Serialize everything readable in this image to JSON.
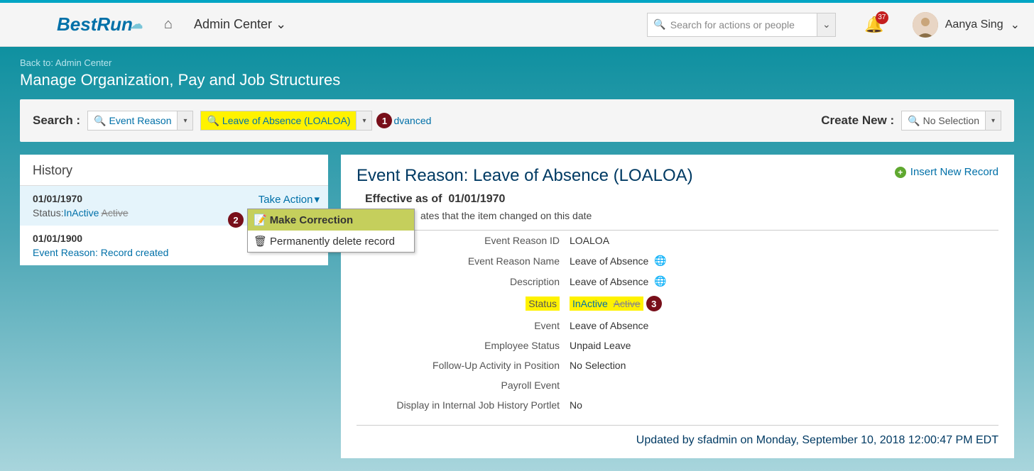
{
  "header": {
    "logo": "BestRun",
    "nav_label": "Admin Center",
    "search_placeholder": "Search for actions or people",
    "notif_count": "37",
    "user_name": "Aanya Sing"
  },
  "breadcrumb": {
    "back": "Back to: Admin Center",
    "title": "Manage Organization, Pay and Job Structures"
  },
  "searchbar": {
    "label": "Search :",
    "filter1": "Event Reason",
    "filter2": "Leave of Absence (LOALOA)",
    "advanced": "dvanced",
    "create_label": "Create New :",
    "create_value": "No Selection"
  },
  "callouts": {
    "c1": "1",
    "c2": "2",
    "c3": "3"
  },
  "history": {
    "title": "History",
    "items": [
      {
        "date": "01/01/1970",
        "status_label": "Status:",
        "status_val": "InActive",
        "status_old": "Active",
        "action": "Take Action"
      },
      {
        "date": "01/01/1900",
        "sub": "Event Reason: Record created"
      }
    ],
    "menu": {
      "correct": "Make Correction",
      "delete": "Permanently delete record"
    }
  },
  "detail": {
    "title": "Event Reason: Leave of Absence (LOALOA)",
    "insert": "Insert New Record",
    "effective_label": "Effective as of",
    "effective_date": "01/01/1970",
    "note": "ates that the item changed on this date",
    "fields": {
      "id_label": "Event Reason ID",
      "id_val": "LOALOA",
      "name_label": "Event Reason Name",
      "name_val": "Leave of Absence",
      "desc_label": "Description",
      "desc_val": "Leave of Absence",
      "status_label": "Status",
      "status_val": "InActive",
      "status_old": "Active",
      "event_label": "Event",
      "event_val": "Leave of Absence",
      "emp_label": "Employee Status",
      "emp_val": "Unpaid Leave",
      "follow_label": "Follow-Up Activity in Position",
      "follow_val": "No Selection",
      "payroll_label": "Payroll Event",
      "payroll_val": "",
      "display_label": "Display in Internal Job History Portlet",
      "display_val": "No"
    },
    "updated": "Updated by sfadmin on Monday, September 10, 2018 12:00:47 PM EDT"
  }
}
